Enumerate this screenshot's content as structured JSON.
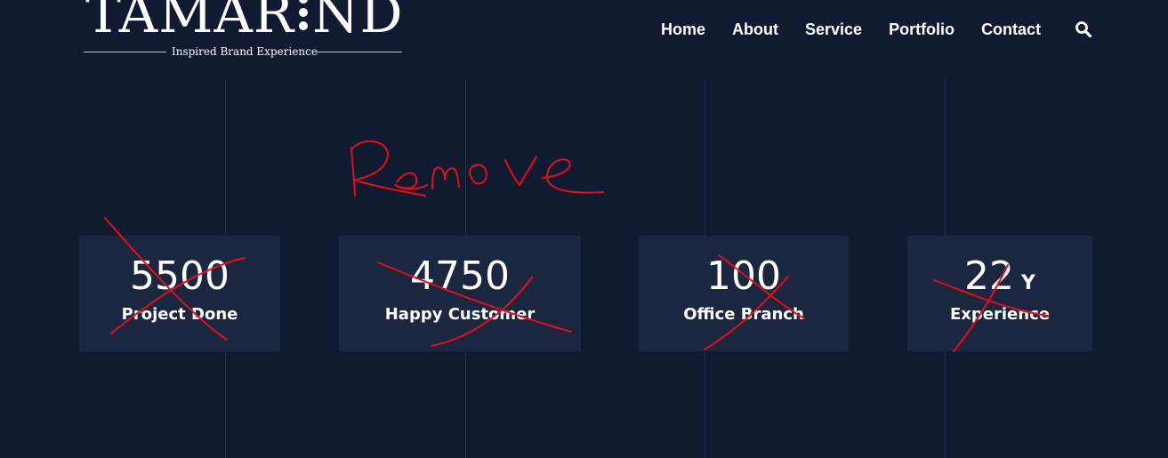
{
  "logo": {
    "wordmark_left": "TAMAR",
    "wordmark_right": "ND",
    "tagline": "Inspired Brand Experience"
  },
  "nav": {
    "items": [
      "Home",
      "About",
      "Service",
      "Portfolio",
      "Contact"
    ],
    "search_icon": "search-icon"
  },
  "stats": [
    {
      "value": "5500",
      "label": "Project Done"
    },
    {
      "value": "4750",
      "label": "Happy Customer"
    },
    {
      "value": "100",
      "label": "Office Branch"
    },
    {
      "value": "22",
      "unit": "Y",
      "label": "Experience"
    }
  ],
  "annotation": {
    "text": "Remove",
    "color": "#e3101b"
  },
  "colors": {
    "background": "#101a31",
    "card": "#1b2641",
    "divider": "#22304c",
    "text": "#ffffff"
  }
}
